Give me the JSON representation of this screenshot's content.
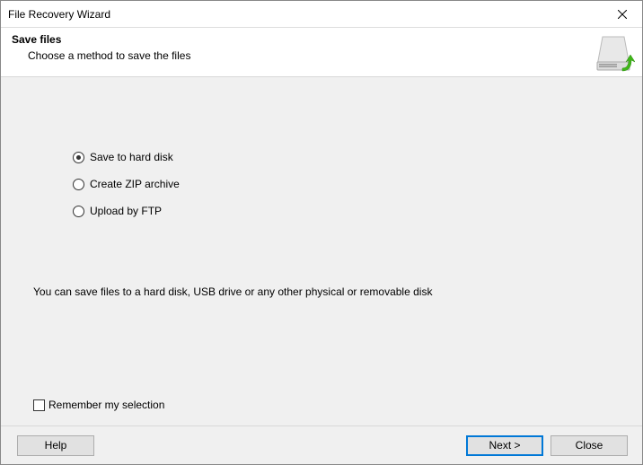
{
  "window": {
    "title": "File Recovery Wizard"
  },
  "header": {
    "title": "Save files",
    "subtitle": "Choose a method to save the files"
  },
  "options": {
    "hard_disk": "Save to hard disk",
    "zip": "Create ZIP archive",
    "ftp": "Upload by FTP"
  },
  "description": "You can save files to a hard disk, USB drive or any other physical or removable disk",
  "remember": {
    "label": "Remember my selection"
  },
  "buttons": {
    "help": "Help",
    "next": "Next >",
    "close": "Close"
  }
}
